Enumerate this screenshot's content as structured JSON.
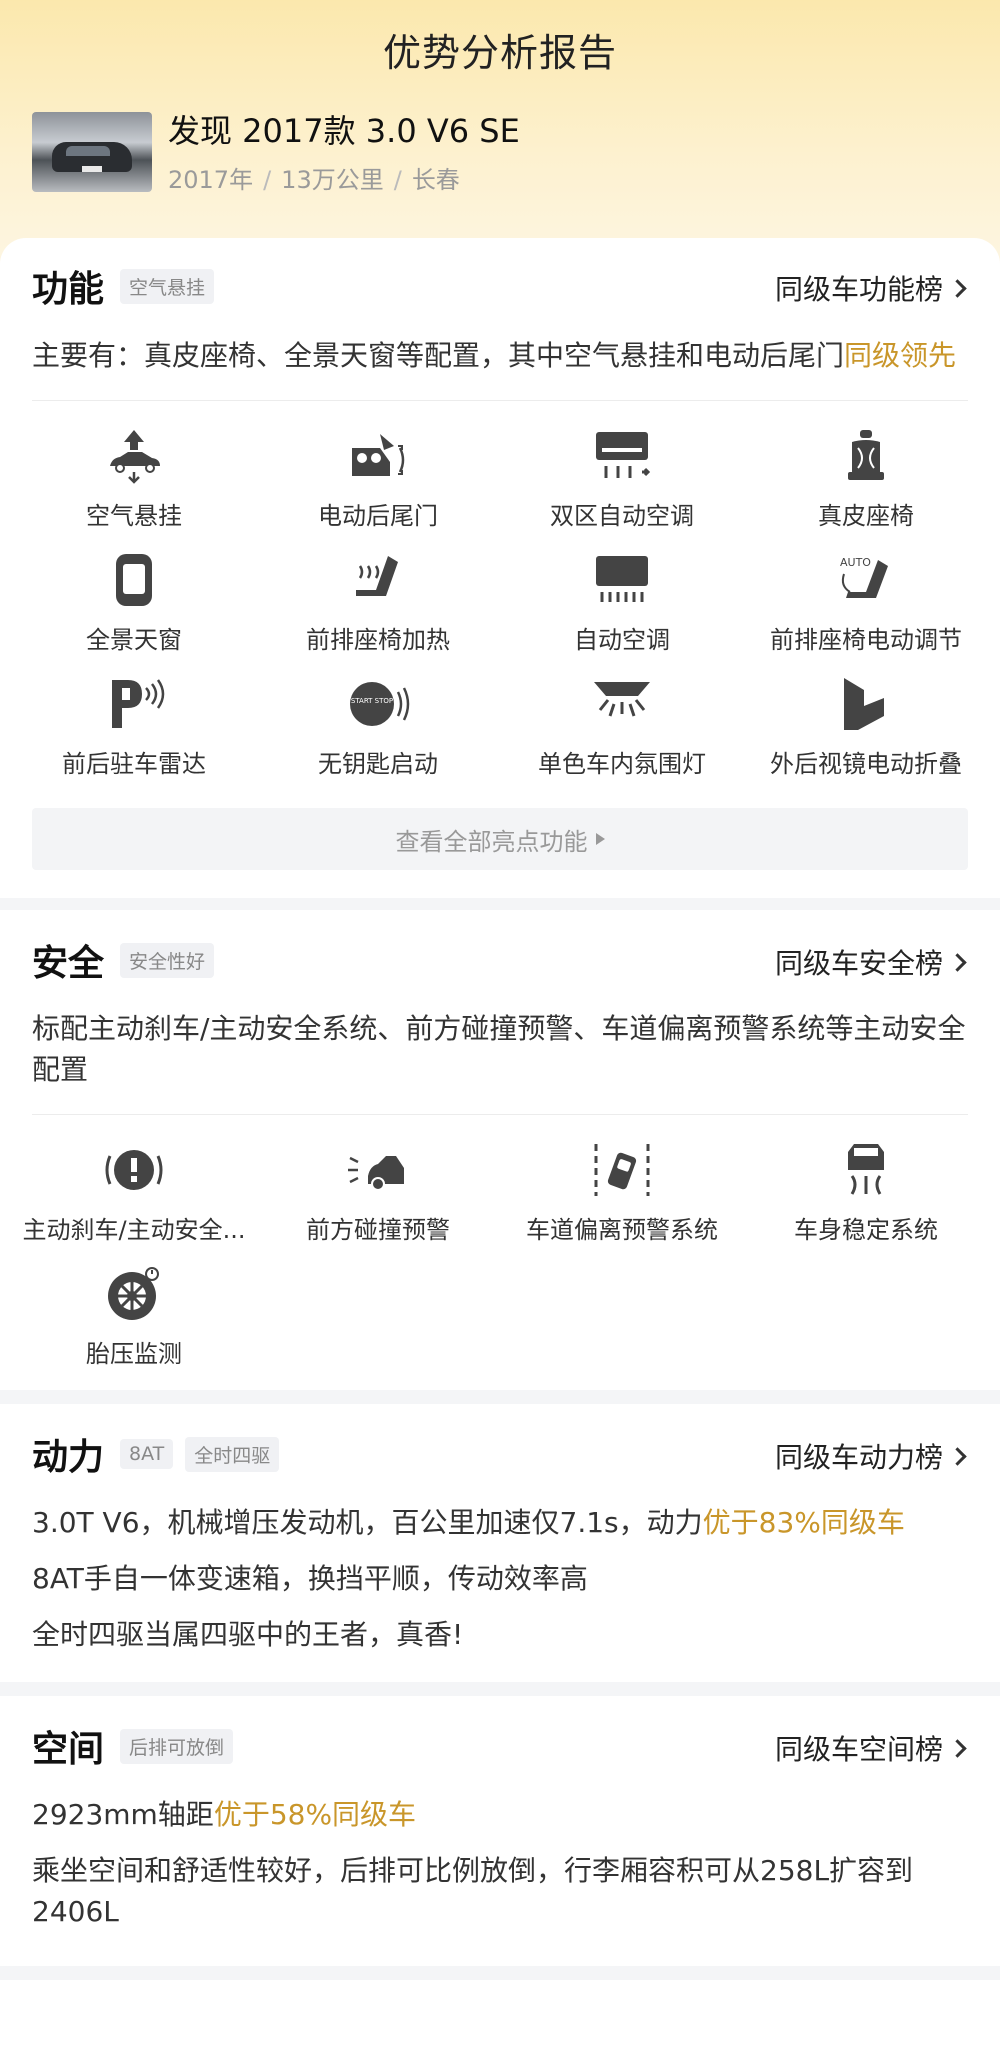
{
  "page": {
    "title": "优势分析报告"
  },
  "car": {
    "name": "发现 2017款 3.0 V6 SE",
    "year": "2017年",
    "mileage": "13万公里",
    "city": "长春"
  },
  "function": {
    "title": "功能",
    "tags": [
      "空气悬挂"
    ],
    "rank_link": "同级车功能榜",
    "desc_prefix": "主要有：真皮座椅、全景天窗等配置，其中空气悬挂和电动后尾门",
    "desc_highlight": "同级领先",
    "features": [
      {
        "label": "空气悬挂",
        "icon": "air-suspension-icon"
      },
      {
        "label": "电动后尾门",
        "icon": "power-tailgate-icon"
      },
      {
        "label": "双区自动空调",
        "icon": "dual-zone-ac-icon"
      },
      {
        "label": "真皮座椅",
        "icon": "leather-seat-icon"
      },
      {
        "label": "全景天窗",
        "icon": "panoramic-sunroof-icon"
      },
      {
        "label": "前排座椅加热",
        "icon": "seat-heating-icon"
      },
      {
        "label": "自动空调",
        "icon": "auto-ac-icon"
      },
      {
        "label": "前排座椅电动调节",
        "icon": "power-seat-icon"
      },
      {
        "label": "前后驻车雷达",
        "icon": "parking-radar-icon"
      },
      {
        "label": "无钥匙启动",
        "icon": "keyless-start-icon"
      },
      {
        "label": "单色车内氛围灯",
        "icon": "ambient-light-icon"
      },
      {
        "label": "外后视镜电动折叠",
        "icon": "mirror-fold-icon"
      }
    ],
    "more_label": "查看全部亮点功能",
    "auto_text": "AUTO",
    "start_text": "START STOP"
  },
  "safety": {
    "title": "安全",
    "tags": [
      "安全性好"
    ],
    "rank_link": "同级车安全榜",
    "desc": "标配主动刹车/主动安全系统、前方碰撞预警、车道偏离预警系统等主动安全配置",
    "features": [
      {
        "label": "主动刹车/主动安全...",
        "icon": "active-brake-icon"
      },
      {
        "label": "前方碰撞预警",
        "icon": "collision-warning-icon"
      },
      {
        "label": "车道偏离预警系统",
        "icon": "lane-departure-icon"
      },
      {
        "label": "车身稳定系统",
        "icon": "stability-control-icon"
      },
      {
        "label": "胎压监测",
        "icon": "tire-pressure-icon"
      }
    ]
  },
  "power": {
    "title": "动力",
    "tags": [
      "8AT",
      "全时四驱"
    ],
    "rank_link": "同级车动力榜",
    "line1_prefix": "3.0T V6，机械增压发动机，百公里加速仅7.1s，动力",
    "line1_highlight": "优于83%同级车",
    "line2": "8AT手自一体变速箱，换挡平顺，传动效率高",
    "line3": "全时四驱当属四驱中的王者，真香!"
  },
  "space": {
    "title": "空间",
    "tags": [
      "后排可放倒"
    ],
    "rank_link": "同级车空间榜",
    "line1_prefix": "2923mm轴距",
    "line1_highlight": "优于58%同级车",
    "line2": "乘坐空间和舒适性较好，后排可比例放倒，行李厢容积可从258L扩容到2406L"
  },
  "colors": {
    "highlight": "#c9962a",
    "hero": "#fbe8ad"
  }
}
